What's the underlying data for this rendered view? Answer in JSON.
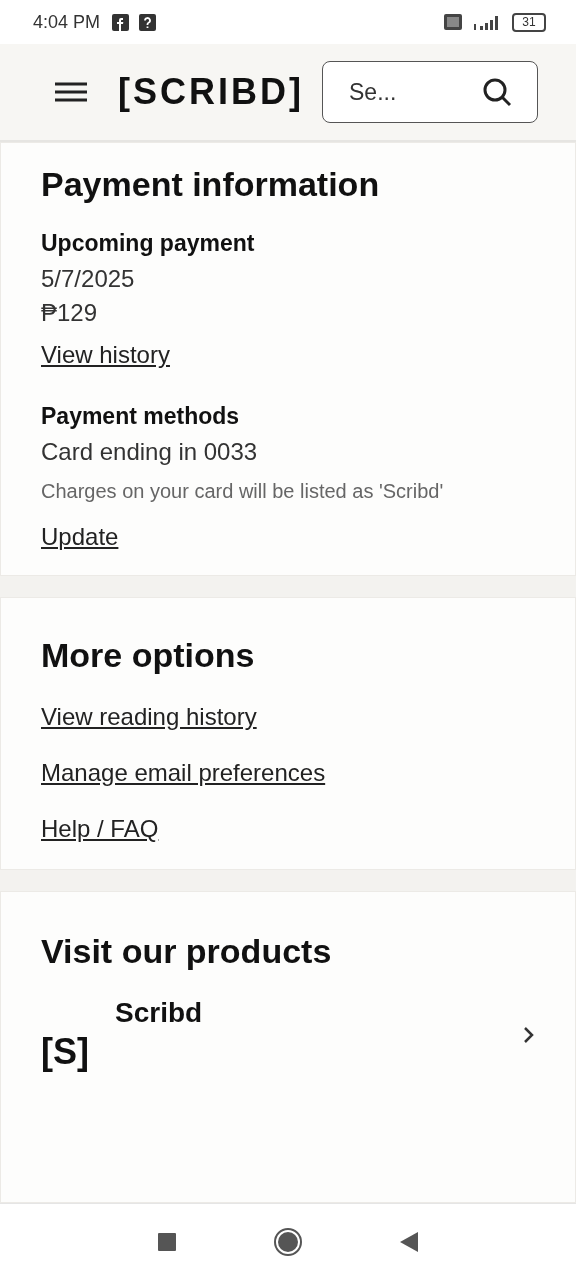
{
  "status_bar": {
    "time": "4:04 PM",
    "battery": "31"
  },
  "header": {
    "logo": "[SCRIBD]",
    "search": {
      "placeholder": "Se..."
    }
  },
  "payment": {
    "title": "Payment information",
    "upcoming": {
      "label": "Upcoming payment",
      "date": "5/7/2025",
      "amount": "₱129",
      "link": "View history"
    },
    "methods": {
      "label": "Payment methods",
      "card": "Card ending in 0033",
      "note": "Charges on your card will be listed as 'Scribd'",
      "link": "Update"
    }
  },
  "more_options": {
    "title": "More options",
    "links": [
      "View reading history",
      "Manage email preferences",
      "Help / FAQ"
    ]
  },
  "products": {
    "title": "Visit our products",
    "items": [
      {
        "logo": "[S]",
        "name": "Scribd"
      }
    ]
  }
}
